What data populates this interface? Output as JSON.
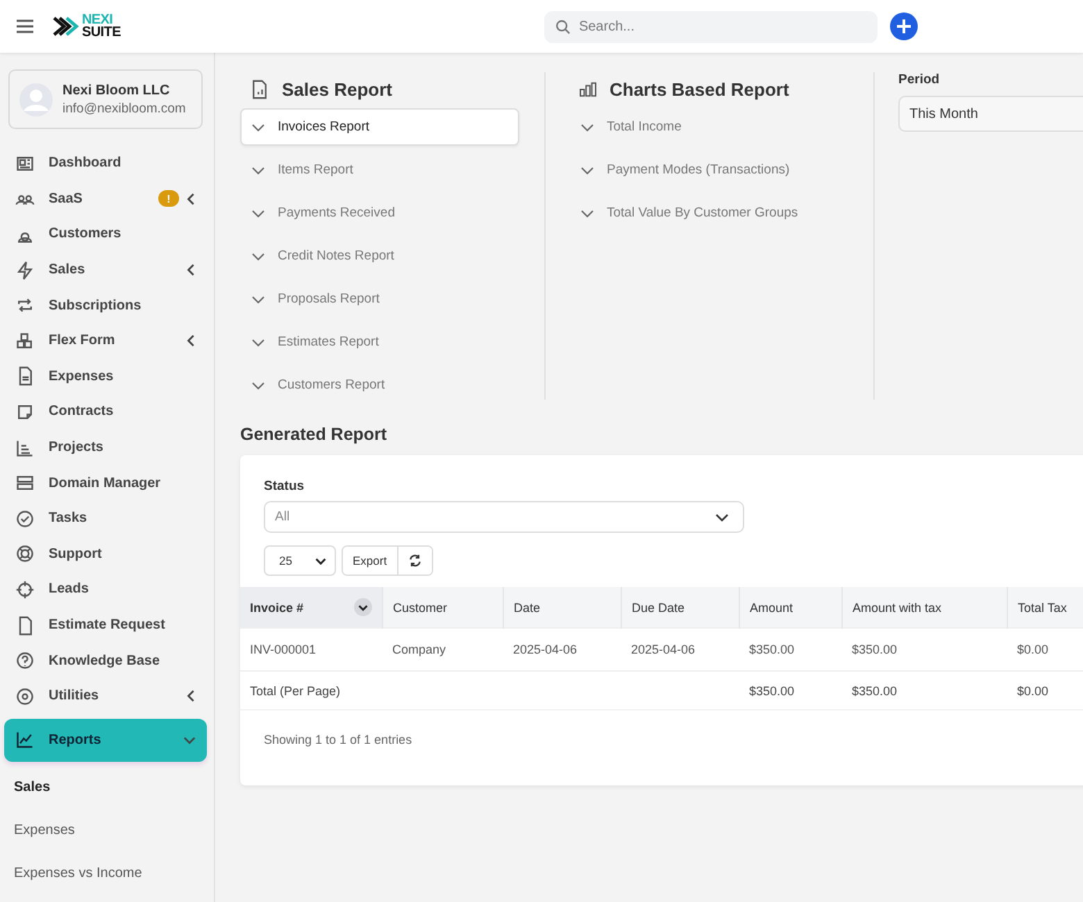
{
  "header": {
    "logo_top": "NEXI",
    "logo_bottom": "SUITE",
    "search": {
      "placeholder": "Search..."
    }
  },
  "profile": {
    "name": "Nexi Bloom LLC",
    "email": "info@nexibloom.com"
  },
  "sidebar": {
    "items": [
      {
        "label": "Dashboard",
        "selected": false,
        "submenu": false
      },
      {
        "label": "SaaS",
        "selected": false,
        "submenu": true,
        "expanded": false,
        "badge": "!"
      },
      {
        "label": "Customers",
        "selected": false,
        "submenu": false
      },
      {
        "label": "Sales",
        "selected": false,
        "submenu": true,
        "expanded": false
      },
      {
        "label": "Subscriptions",
        "selected": false,
        "submenu": false
      },
      {
        "label": "Flex Form",
        "selected": false,
        "submenu": true,
        "expanded": false
      },
      {
        "label": "Expenses",
        "selected": false,
        "submenu": false
      },
      {
        "label": "Contracts",
        "selected": false,
        "submenu": false
      },
      {
        "label": "Projects",
        "selected": false,
        "submenu": false
      },
      {
        "label": "Domain Manager",
        "selected": false,
        "submenu": false
      },
      {
        "label": "Tasks",
        "selected": false,
        "submenu": false
      },
      {
        "label": "Support",
        "selected": false,
        "submenu": false
      },
      {
        "label": "Leads",
        "selected": false,
        "submenu": false
      },
      {
        "label": "Estimate Request",
        "selected": false,
        "submenu": false
      },
      {
        "label": "Knowledge Base",
        "selected": false,
        "submenu": false
      },
      {
        "label": "Utilities",
        "selected": false,
        "submenu": true,
        "expanded": false
      },
      {
        "label": "Reports",
        "selected": true,
        "submenu": true,
        "expanded": true
      }
    ],
    "subitems": [
      {
        "label": "Sales",
        "selected": true
      },
      {
        "label": "Expenses",
        "selected": false
      },
      {
        "label": "Expenses vs Income",
        "selected": false
      }
    ]
  },
  "sales_report": {
    "title": "Sales Report",
    "items": [
      {
        "label": "Invoices Report",
        "selected": true
      },
      {
        "label": "Items Report",
        "selected": false
      },
      {
        "label": "Payments Received",
        "selected": false
      },
      {
        "label": "Credit Notes Report",
        "selected": false
      },
      {
        "label": "Proposals Report",
        "selected": false
      },
      {
        "label": "Estimates Report",
        "selected": false
      },
      {
        "label": "Customers Report",
        "selected": false
      }
    ]
  },
  "charts_report": {
    "title": "Charts Based Report",
    "items": [
      "Total Income",
      "Payment Modes (Transactions)",
      "Total Value By Customer Groups"
    ]
  },
  "period": {
    "label": "Period",
    "value": "This Month"
  },
  "generated_report": {
    "title": "Generated Report",
    "status": {
      "label": "Status",
      "value": "All"
    },
    "page_size": "25",
    "export": "Export",
    "columns": [
      "Invoice #",
      "Customer",
      "Date",
      "Due Date",
      "Amount",
      "Amount with tax",
      "Total Tax"
    ],
    "rows": [
      [
        "INV-000001",
        "Company",
        "2025-04-06",
        "2025-04-06",
        "$350.00",
        "$350.00",
        "$0.00"
      ]
    ],
    "footer": {
      "label": "Total (Per Page)",
      "amount": "$350.00",
      "amount_with_tax": "$350.00",
      "total_tax": "$0.00"
    },
    "info": "Showing 1 to 1 of 1 entries"
  }
}
